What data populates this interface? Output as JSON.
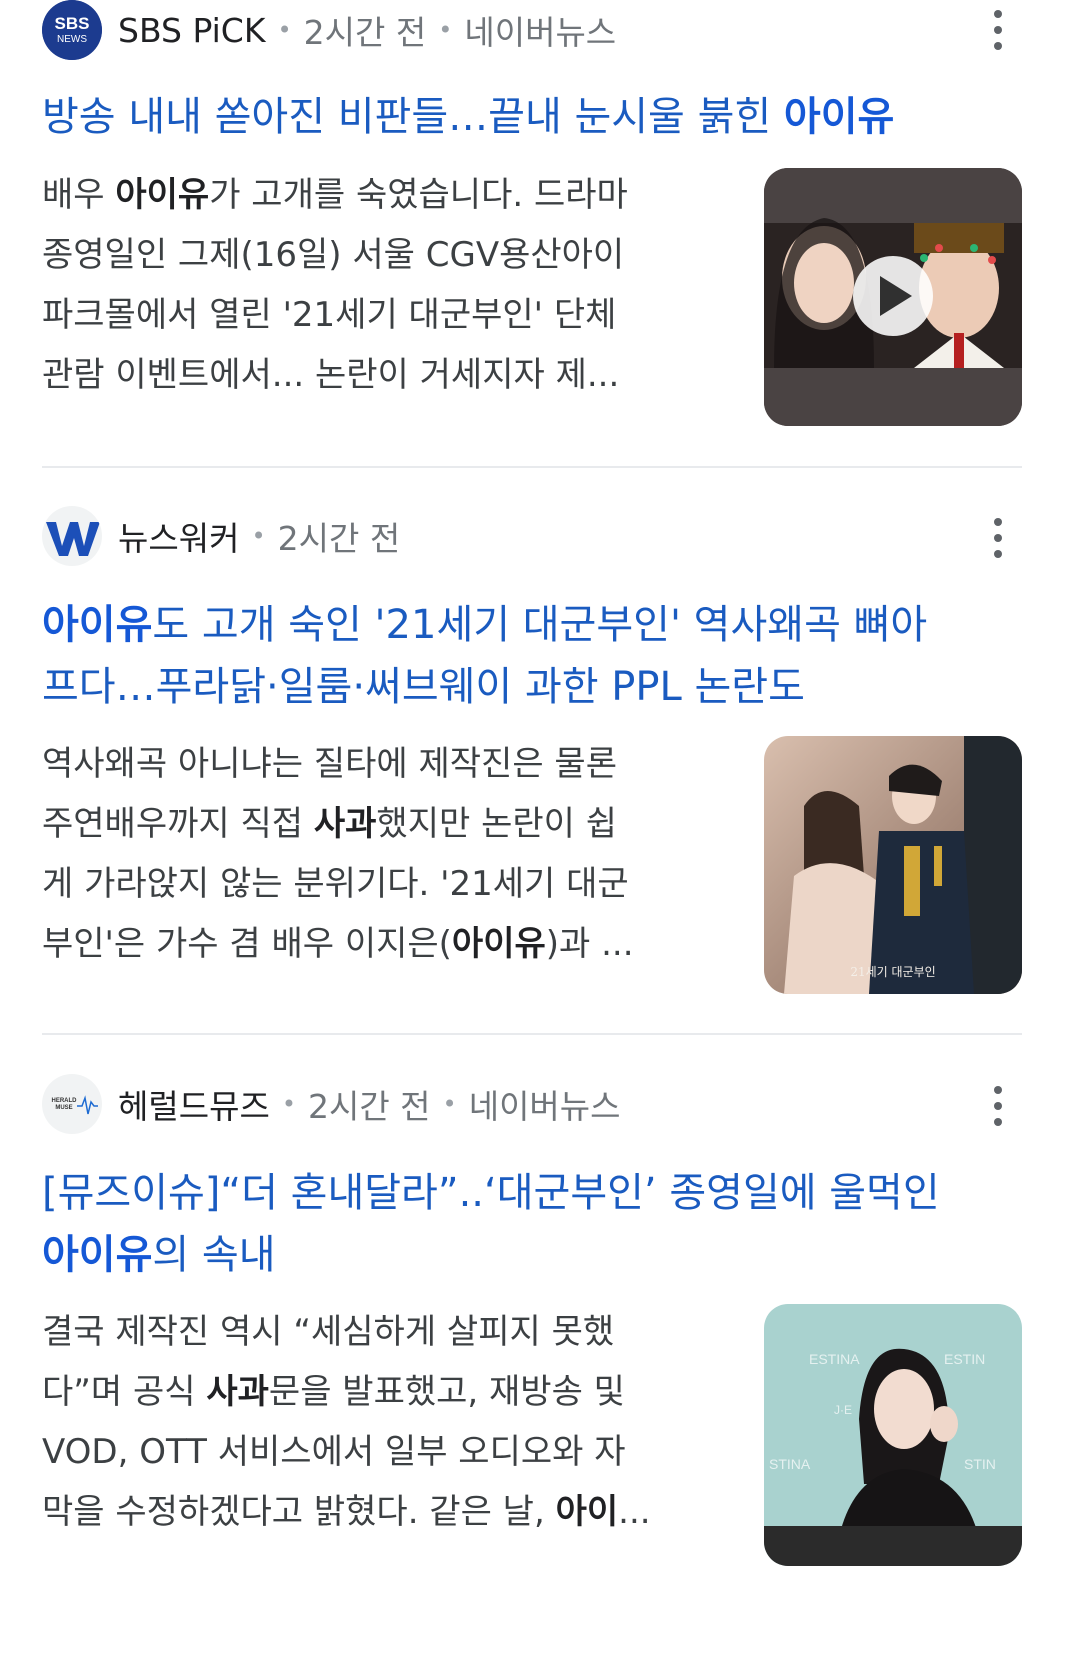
{
  "articles": [
    {
      "source": "SBS PiCK",
      "logo_text": "SBS NEWS",
      "time": "2시간 전",
      "provider": "네이버뉴스",
      "title_lines": [
        [
          "방송 내내 쏟아진 비판들…끝내 눈시울 붉힌 ",
          "아이유",
          ""
        ]
      ],
      "snippet_lines": [
        [
          "배우 ",
          "아이유",
          "가 고개를 숙였습니다. 드라마"
        ],
        [
          "종영일인 그제(16일) 서울 CGV용산아이",
          "",
          ""
        ],
        [
          "파크몰에서 열린 '21세기 대군부인' 단체",
          "",
          ""
        ],
        [
          "관람 이벤트에서... 논란이 거세지자 제...",
          "",
          ""
        ]
      ],
      "has_video": true
    },
    {
      "source": "뉴스워커",
      "logo_text": "W",
      "time": "2시간 전",
      "provider": "",
      "title_lines": [
        [
          "",
          "아이유",
          "도 고개 숙인 '21세기 대군부인' 역사왜곡 뼈아"
        ],
        [
          "프다…푸라닭·일룸·써브웨이 과한 PPL 논란도",
          "",
          ""
        ]
      ],
      "snippet_lines": [
        [
          "역사왜곡 아니냐는 질타에 제작진은 물론",
          "",
          ""
        ],
        [
          "주연배우까지 직접 ",
          "사과",
          "했지만 논란이 쉽"
        ],
        [
          "게 가라앉지 않는 분위기다. '21세기 대군",
          "",
          ""
        ],
        [
          "부인'은 가수 겸 배우 이지은(",
          "아이유",
          ")과 ..."
        ]
      ],
      "poster_caption": "21세기 대군부인"
    },
    {
      "source": "헤럴드뮤즈",
      "logo_text": "HERALD MUSE",
      "time": "2시간 전",
      "provider": "네이버뉴스",
      "title_lines": [
        [
          "[뮤즈이슈]“더 혼내달라”..‘대군부인’ 종영일에 울먹인",
          "",
          ""
        ],
        [
          "",
          "아이유",
          "의 속내"
        ]
      ],
      "snippet_lines": [
        [
          "결국 제작진 역시 “세심하게 살피지 못했",
          "",
          ""
        ],
        [
          "다”며 공식 ",
          "사과",
          "문을 발표했고, 재방송 및"
        ],
        [
          "VOD, OTT 서비스에서 일부 오디오와 자",
          "",
          ""
        ],
        [
          "막을 수정하겠다고 밝혔다. 같은 날, ",
          "아이",
          "..."
        ]
      ]
    }
  ],
  "colors": {
    "title_blue": "#1a5bc0",
    "meta_gray": "#70757a",
    "snippet": "#3c4043"
  }
}
